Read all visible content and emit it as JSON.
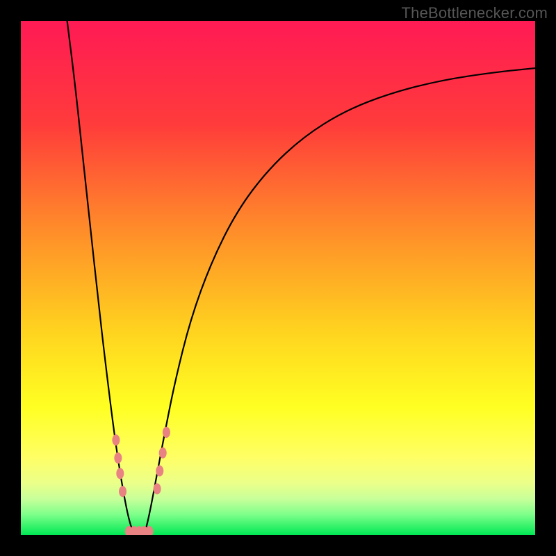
{
  "watermark": "TheBottlenecker.com",
  "chart_data": {
    "type": "line",
    "title": "",
    "xlabel": "",
    "ylabel": "",
    "xlim": [
      0,
      100
    ],
    "ylim": [
      0,
      100
    ],
    "gradient_stops": [
      {
        "pct": 0,
        "color": "#ff1a54"
      },
      {
        "pct": 20,
        "color": "#ff3b3b"
      },
      {
        "pct": 40,
        "color": "#ff8a2a"
      },
      {
        "pct": 60,
        "color": "#ffd21f"
      },
      {
        "pct": 75,
        "color": "#ffff22"
      },
      {
        "pct": 85,
        "color": "#ffff66"
      },
      {
        "pct": 90,
        "color": "#eaff8a"
      },
      {
        "pct": 93,
        "color": "#c7ff9a"
      },
      {
        "pct": 96,
        "color": "#7dff8a"
      },
      {
        "pct": 100,
        "color": "#00e854"
      }
    ],
    "series": [
      {
        "name": "left-curve",
        "color": "#000000",
        "width": 2.2,
        "points": [
          {
            "x": 9.0,
            "y": 100.0
          },
          {
            "x": 10.5,
            "y": 88.0
          },
          {
            "x": 12.0,
            "y": 74.0
          },
          {
            "x": 13.5,
            "y": 60.0
          },
          {
            "x": 15.0,
            "y": 46.0
          },
          {
            "x": 16.5,
            "y": 33.0
          },
          {
            "x": 18.0,
            "y": 21.0
          },
          {
            "x": 19.0,
            "y": 14.0
          },
          {
            "x": 20.0,
            "y": 8.0
          },
          {
            "x": 21.0,
            "y": 3.0
          },
          {
            "x": 22.0,
            "y": 0.0
          }
        ]
      },
      {
        "name": "right-curve",
        "color": "#000000",
        "width": 2.2,
        "points": [
          {
            "x": 24.0,
            "y": 0.0
          },
          {
            "x": 25.0,
            "y": 4.0
          },
          {
            "x": 26.5,
            "y": 12.0
          },
          {
            "x": 28.0,
            "y": 20.0
          },
          {
            "x": 30.0,
            "y": 30.0
          },
          {
            "x": 33.0,
            "y": 42.0
          },
          {
            "x": 37.0,
            "y": 53.0
          },
          {
            "x": 42.0,
            "y": 63.0
          },
          {
            "x": 48.0,
            "y": 71.0
          },
          {
            "x": 55.0,
            "y": 77.5
          },
          {
            "x": 63.0,
            "y": 82.5
          },
          {
            "x": 72.0,
            "y": 86.0
          },
          {
            "x": 82.0,
            "y": 88.5
          },
          {
            "x": 92.0,
            "y": 90.0
          },
          {
            "x": 100.0,
            "y": 90.8
          }
        ]
      }
    ],
    "markers": {
      "color": "#e98282",
      "rx": 5.5,
      "ry": 8,
      "points": [
        {
          "x": 18.5,
          "y": 18.5
        },
        {
          "x": 18.9,
          "y": 15.0
        },
        {
          "x": 19.3,
          "y": 12.0
        },
        {
          "x": 19.8,
          "y": 8.5
        },
        {
          "x": 21.0,
          "y": 0.7
        },
        {
          "x": 22.0,
          "y": 0.7
        },
        {
          "x": 23.0,
          "y": 0.7
        },
        {
          "x": 24.0,
          "y": 0.7
        },
        {
          "x": 25.0,
          "y": 0.7
        },
        {
          "x": 26.5,
          "y": 9.0
        },
        {
          "x": 27.0,
          "y": 12.5
        },
        {
          "x": 27.6,
          "y": 16.0
        },
        {
          "x": 28.3,
          "y": 20.0
        }
      ]
    }
  }
}
